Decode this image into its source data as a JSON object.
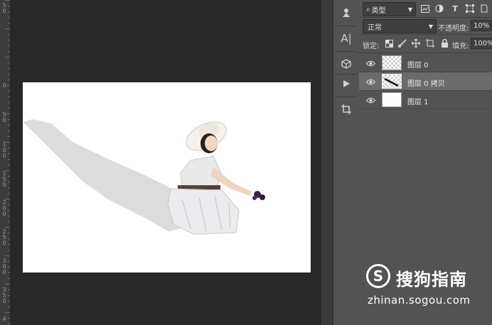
{
  "ruler": {
    "labels": [
      "50",
      "0",
      "50",
      "100",
      "150",
      "200",
      "250",
      "300",
      "350",
      "4"
    ]
  },
  "tools": {
    "items": [
      "puppet-warp-icon",
      "character-panel-icon",
      "3d-object-icon",
      "play-action-icon",
      "crop-icon"
    ],
    "type_tool_glyph": "A|"
  },
  "layers_panel": {
    "filter_kind": "类型",
    "blend_mode": "正常",
    "opacity_label": "不透明度:",
    "opacity_value": "10%",
    "lock_label": "锁定:",
    "fill_label": "填充:",
    "fill_value": "100%",
    "layers": [
      {
        "name": "图层 0",
        "visible": true,
        "selected": false,
        "thumb": "transparent"
      },
      {
        "name": "图层 0 拷贝",
        "visible": true,
        "selected": true,
        "thumb": "transparent"
      },
      {
        "name": "图层 1",
        "visible": true,
        "selected": false,
        "thumb": "white"
      }
    ]
  },
  "watermark": {
    "logo_letter": "S",
    "brand": "搜狗指南",
    "url": "zhinan.sogou.com"
  },
  "colors": {
    "background": "#2b2b2b",
    "panel": "#535353",
    "selected_layer": "#6b6b6b",
    "document": "#ffffff"
  }
}
